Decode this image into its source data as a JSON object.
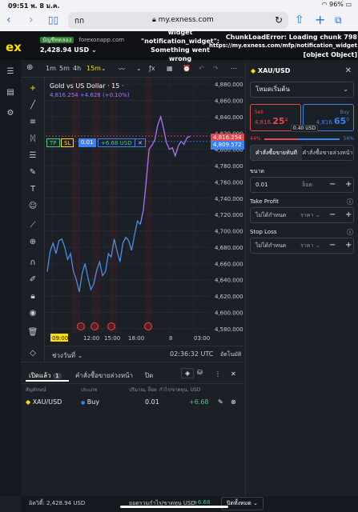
{
  "status_bar": {
    "time": "09:51",
    "date": "พ. 8 ม.ค.",
    "battery": "96%"
  },
  "browser": {
    "reader_label": "กก",
    "url": "my.exness.com"
  },
  "header": {
    "account_type": "บัญชีทดลอง",
    "broker": "forexonapp.com",
    "balance": "2,428.94 USD",
    "error_center": [
      "widget",
      "\"notification_widget\":",
      "Something went",
      "wrong"
    ],
    "error_right": [
      "ChunkLoadError: Loading chunk 798",
      "https://my.exness.com/mfp/notification_widget",
      "[object Object]"
    ]
  },
  "chart_toolbar": {
    "tf_1m": "1m",
    "tf_5m": "5m",
    "tf_4h": "4h",
    "tf_15m": "15m"
  },
  "chart": {
    "legend_title": "Gold vs US Dollar · 15 ·",
    "legend_values": "4,816.254  +4.628 (+0.10%)",
    "position_tp": "TP",
    "position_sl": "SL",
    "position_volume": "0.01",
    "position_pnl": "+6.68 USD",
    "bid_label": "4,816.254",
    "ask_label": "4,809.572",
    "period_label": "ช่วงวันที่",
    "time": "02:36:32 UTC",
    "auto": "อัตโนมัติ"
  },
  "chart_data": {
    "type": "line",
    "title": "Gold vs US Dollar · 15 ·",
    "y_ticks": [
      "4,880.000",
      "4,860.000",
      "4,840.000",
      "4,820.000",
      "4,800.000",
      "4,780.000",
      "4,760.000",
      "4,740.000",
      "4,720.000",
      "4,700.000",
      "4,680.000",
      "4,660.000",
      "4,640.000",
      "4,620.000",
      "4,600.000",
      "4,580.000"
    ],
    "ylim": [
      4575,
      4885
    ],
    "x_ticks": [
      "09:00",
      "12:00",
      "15:00",
      "18:00",
      "8",
      "03:00"
    ],
    "series": [
      {
        "color": "#4a90e2",
        "values": [
          4650,
          4675,
          4685,
          4672,
          4688,
          4690,
          4680,
          4665,
          4672,
          4650,
          4640,
          4625,
          4648,
          4660,
          4642,
          4628,
          4635,
          4652,
          4662,
          4645,
          4650,
          4672,
          4668,
          4690,
          4675,
          4662,
          4685,
          4692,
          4688,
          4676,
          4695,
          4712,
          4708
        ]
      },
      {
        "color": "#a873ff",
        "values": [
          4708,
          4725,
          4760,
          4800,
          4805,
          4812,
          4830,
          4840,
          4825,
          4808,
          4800,
          4802,
          4792,
          4804,
          4810,
          4806,
          4814,
          4816
        ]
      }
    ]
  },
  "order_panel": {
    "symbol": "XAU/USD",
    "mode": "โหมดเริ่มต้น",
    "sell_label": "Sell",
    "sell_price_main": "4,816.",
    "sell_price_big": "25",
    "sell_price_small": "4",
    "buy_label": "Buy",
    "buy_price_main": "4,816.",
    "buy_price_big": "65",
    "buy_price_small": "0",
    "spread": "0.40 USD",
    "sell_pct": "44%",
    "buy_pct": "56%",
    "tab_market": "คำสั่งซื้อขายทันที",
    "tab_pending": "คำสั่งซื้อขายล่วงหน้า",
    "volume_label": "ขนาด",
    "volume_value": "0.01",
    "volume_unit": "ล็อต",
    "tp_label": "Take Profit",
    "tp_value": "ไม่ได้กำหนด",
    "tp_unit": "ราคา",
    "sl_label": "Stop Loss",
    "sl_value": "ไม่ได้กำหนด",
    "sl_unit": "ราคา"
  },
  "positions": {
    "tab_open": "เปิดแล้ว",
    "tab_open_count": "1",
    "tab_pending": "คำสั่งซื้อขายล่วงหน้า",
    "tab_closed": "ปิด",
    "col_symbol": "สัญลักษณ์",
    "col_type": "ประเภท",
    "col_volume": "ปริมาณ, ล็อต",
    "col_pnl": "กำไร/ขาดทุน, USD",
    "rows": [
      {
        "symbol": "XAU/USD",
        "type": "Buy",
        "volume": "0.01",
        "pnl": "+6.68"
      }
    ]
  },
  "footer": {
    "equity_label": "อิควิตี้:",
    "equity": "2,428.94 USD",
    "total_pnl_label": "ยอดรวมกำไร/ขาดทุน USD:",
    "total_pnl": "+6.68",
    "close_all": "ปิดทั้งหมด"
  },
  "colors": {
    "accent": "#ffde02",
    "sell": "#e5484d",
    "buy": "#3b82f6",
    "profit": "#4cc38a",
    "bg": "#1b1f26"
  }
}
